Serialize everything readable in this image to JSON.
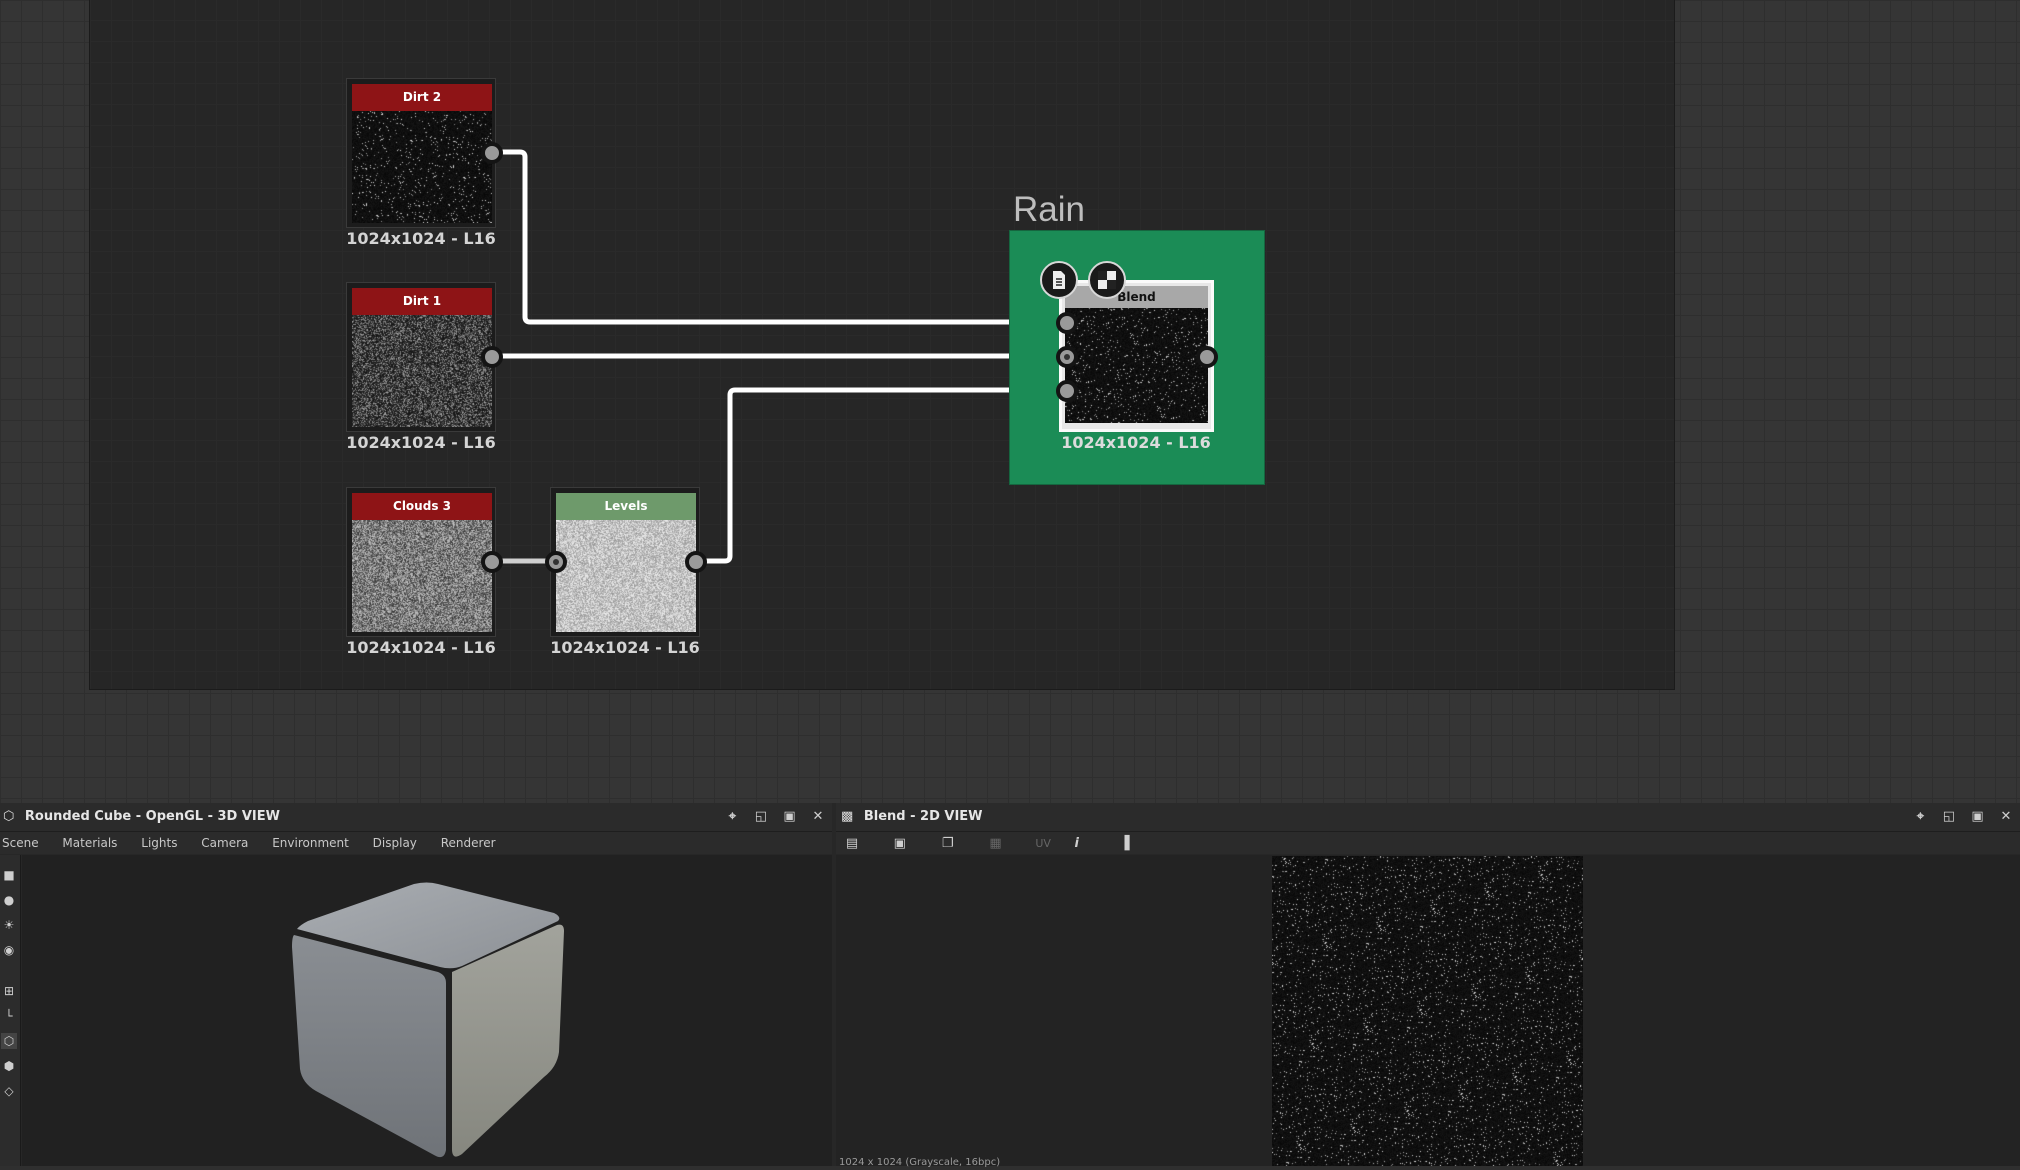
{
  "graph": {
    "frame_title": "Rain",
    "nodes": [
      {
        "id": "dirt2",
        "title": "Dirt 2",
        "resolution": "1024x1024 - L16",
        "header_color": "#8e1416"
      },
      {
        "id": "dirt1",
        "title": "Dirt 1",
        "resolution": "1024x1024 - L16",
        "header_color": "#8e1416"
      },
      {
        "id": "clouds3",
        "title": "Clouds 3",
        "resolution": "1024x1024 - L16",
        "header_color": "#8e1416"
      },
      {
        "id": "levels",
        "title": "Levels",
        "resolution": "1024x1024 - L16",
        "header_color": "#6e9a6b"
      },
      {
        "id": "blend",
        "title": "Blend",
        "resolution": "1024x1024 - L16",
        "header_color": "#a8a8a8"
      }
    ],
    "frame_color": "#1b8c56"
  },
  "panel3d": {
    "title": "Rounded Cube - OpenGL - 3D VIEW",
    "menu": [
      "Scene",
      "Materials",
      "Lights",
      "Camera",
      "Environment",
      "Display",
      "Renderer"
    ]
  },
  "panel2d": {
    "title": "Blend - 2D VIEW",
    "uv_label": "UV",
    "status": "1024 x 1024 (Grayscale, 16bpc)"
  }
}
